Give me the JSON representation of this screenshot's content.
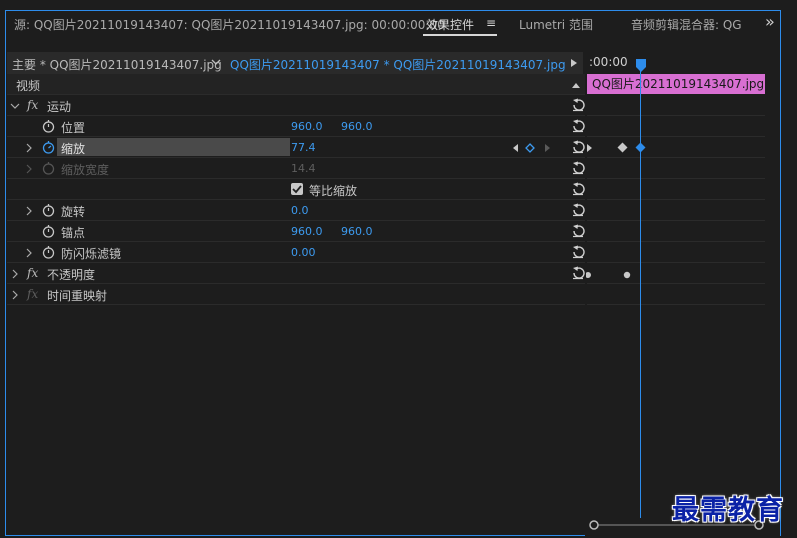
{
  "tabs": {
    "source": "源: QQ图片20211019143407: QQ图片20211019143407.jpg: 00:00:00:00",
    "effect_controls": "效果控件",
    "effect_menu": "≡",
    "lumetri": "Lumetri 范围",
    "audio_mixer": "音频剪辑混合器: QG",
    "overflow": "»"
  },
  "sequence": {
    "main_label": "主要 * QQ图片20211019143407.jpg",
    "clip_selector": "QQ图片20211019143407 * QQ图片20211019143407.jpg",
    "timecode": ":00:00",
    "clip_name": "QQ图片20211019143407.jpg"
  },
  "section_video": "视频",
  "effects": {
    "motion": "运动",
    "position": {
      "label": "位置",
      "x": "960.0",
      "y": "960.0"
    },
    "scale": {
      "label": "缩放",
      "value": "77.4"
    },
    "scale_width": {
      "label": "缩放宽度",
      "value": "14.4"
    },
    "uniform_scale": "等比缩放",
    "rotation": {
      "label": "旋转",
      "value": "0.0"
    },
    "anchor": {
      "label": "锚点",
      "x": "960.0",
      "y": "960.0"
    },
    "anti_flicker": {
      "label": "防闪烁滤镜",
      "value": "0.00"
    },
    "opacity": "不透明度",
    "time_remap": "时间重映射"
  },
  "fx_label": "fx",
  "watermark": "最需教育",
  "colors": {
    "accent": "#2d8ceb",
    "clip": "#d86fd2",
    "value": "#3d9bf0"
  }
}
